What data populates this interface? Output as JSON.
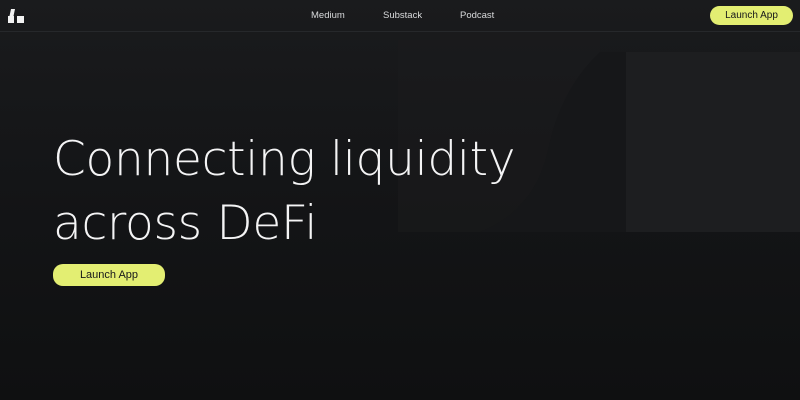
{
  "header": {
    "logo": "fragmented-block-logo",
    "nav": [
      "Medium",
      "Substack",
      "Podcast"
    ],
    "cta_label": "Launch App"
  },
  "hero": {
    "title_line1": "Connecting liquidity",
    "title_line2": "across DeFi",
    "cta_label": "Launch App"
  },
  "colors": {
    "background": "#121315",
    "accent": "#e3ee72",
    "text": "#f4f4f5"
  }
}
